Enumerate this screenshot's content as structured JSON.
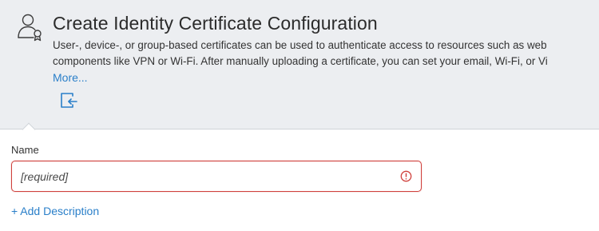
{
  "header": {
    "title": "Create Identity Certificate Configuration",
    "description_lines": [
      "User-, device-, or group-based certificates can be used to authenticate access to resources such as web",
      "components like VPN or Wi-Fi.  After manually uploading a certificate, you can set your email, Wi-Fi, or Vi"
    ],
    "more_link": "More...",
    "icon": "user-certificate-icon",
    "import_icon": "import-icon"
  },
  "form": {
    "name_label": "Name",
    "name_value": "",
    "name_placeholder": "[required]",
    "error_icon": "error-icon",
    "error_color": "#d0413d",
    "add_description_link": "+ Add Description"
  },
  "colors": {
    "header_background": "#eceef1",
    "link": "#2a7fc9",
    "error": "#d0413d"
  }
}
